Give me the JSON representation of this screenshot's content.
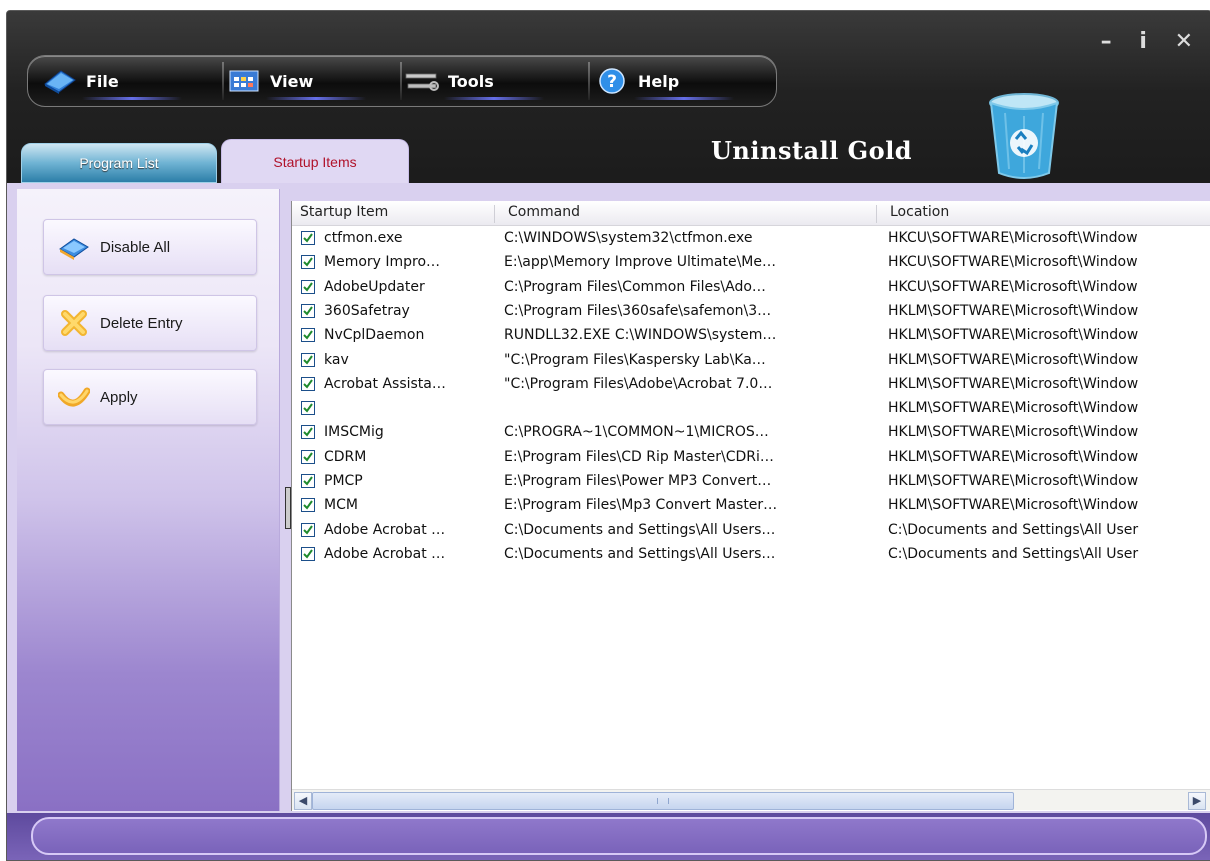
{
  "window": {
    "title": "Uninstall Gold",
    "controls": [
      "–",
      "i",
      "✕"
    ]
  },
  "menu": [
    "File",
    "View",
    "Tools",
    "Help"
  ],
  "tabs": [
    "Program List",
    "Startup Items"
  ],
  "actions": [
    "Disable All",
    "Delete Entry",
    "Apply"
  ],
  "columns": [
    "Startup Item",
    "Command",
    "Location"
  ],
  "rows": [
    {
      "name": "ctfmon.exe",
      "command": "C:\\WINDOWS\\system32\\ctfmon.exe",
      "location": "HKCU\\SOFTWARE\\Microsoft\\Window"
    },
    {
      "name": "Memory Impro…",
      "command": "E:\\app\\Memory Improve Ultimate\\Me…",
      "location": "HKCU\\SOFTWARE\\Microsoft\\Window"
    },
    {
      "name": "AdobeUpdater",
      "command": "C:\\Program Files\\Common Files\\Ado…",
      "location": "HKCU\\SOFTWARE\\Microsoft\\Window"
    },
    {
      "name": "360Safetray",
      "command": "C:\\Program Files\\360safe\\safemon\\3…",
      "location": "HKLM\\SOFTWARE\\Microsoft\\Window"
    },
    {
      "name": "NvCplDaemon",
      "command": "RUNDLL32.EXE C:\\WINDOWS\\system…",
      "location": "HKLM\\SOFTWARE\\Microsoft\\Window"
    },
    {
      "name": "kav",
      "command": "\"C:\\Program Files\\Kaspersky Lab\\Ka…",
      "location": "HKLM\\SOFTWARE\\Microsoft\\Window"
    },
    {
      "name": "Acrobat Assista…",
      "command": "\"C:\\Program Files\\Adobe\\Acrobat 7.0…",
      "location": "HKLM\\SOFTWARE\\Microsoft\\Window"
    },
    {
      "name": "",
      "command": "",
      "location": "HKLM\\SOFTWARE\\Microsoft\\Window"
    },
    {
      "name": "IMSCMig",
      "command": "C:\\PROGRA~1\\COMMON~1\\MICROS…",
      "location": "HKLM\\SOFTWARE\\Microsoft\\Window"
    },
    {
      "name": "CDRM",
      "command": "E:\\Program Files\\CD Rip Master\\CDRi…",
      "location": "HKLM\\SOFTWARE\\Microsoft\\Window"
    },
    {
      "name": "PMCP",
      "command": "E:\\Program Files\\Power MP3 Convert…",
      "location": "HKLM\\SOFTWARE\\Microsoft\\Window"
    },
    {
      "name": "MCM",
      "command": "E:\\Program Files\\Mp3 Convert Master…",
      "location": "HKLM\\SOFTWARE\\Microsoft\\Window"
    },
    {
      "name": "Adobe Acrobat …",
      "command": "C:\\Documents and Settings\\All Users…",
      "location": "C:\\Documents and Settings\\All User"
    },
    {
      "name": "Adobe Acrobat …",
      "command": "C:\\Documents and Settings\\All Users…",
      "location": "C:\\Documents and Settings\\All User"
    }
  ],
  "colors": {
    "accent": "#7a64b8",
    "active_tab_text": "#b0122a"
  },
  "icons": {
    "file": "book-icon",
    "view": "window-icon",
    "tools": "wrench-icon",
    "help": "help-icon",
    "disable_all": "disable-icon",
    "delete_entry": "delete-icon",
    "apply": "apply-icon",
    "recycle_bin": "recycle-bin-icon"
  }
}
